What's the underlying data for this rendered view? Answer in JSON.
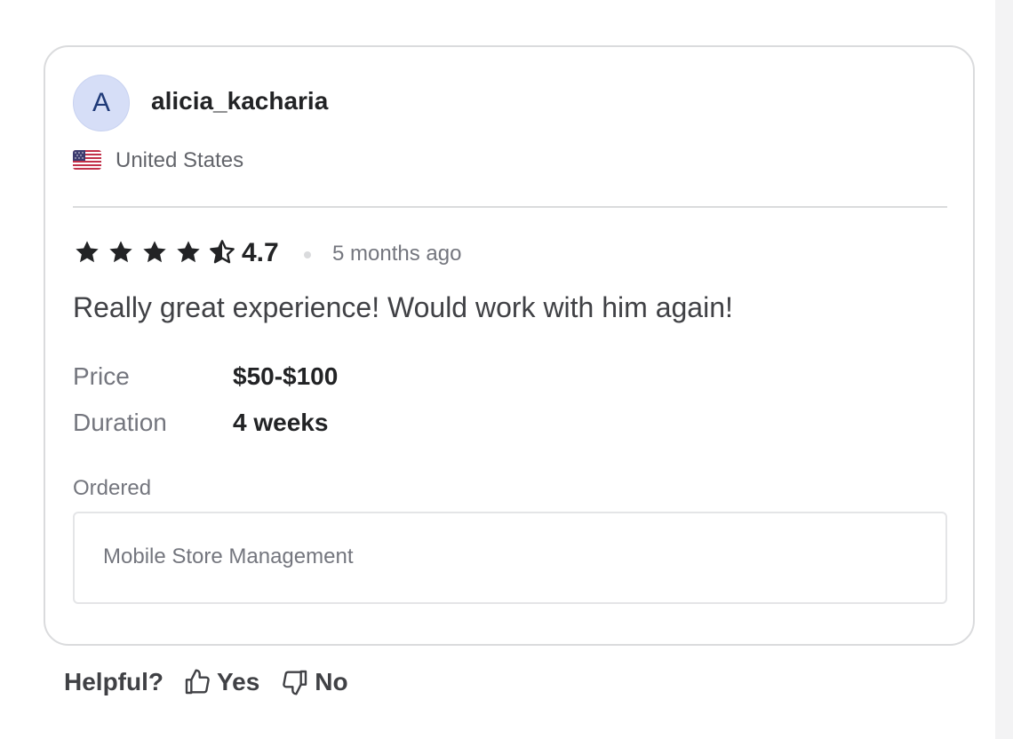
{
  "review": {
    "avatar_initial": "A",
    "username": "alicia_kacharia",
    "country": "United States",
    "flag_icon": "us-flag-icon",
    "rating": 4.7,
    "rating_text": "4.7",
    "stars": [
      "full",
      "full",
      "full",
      "full",
      "half"
    ],
    "time_ago": "5 months ago",
    "text": "Really great experience! Would work with him again!",
    "details": [
      {
        "label": "Price",
        "value": "$50-$100"
      },
      {
        "label": "Duration",
        "value": "4 weeks"
      }
    ],
    "ordered_label": "Ordered",
    "ordered_item": "Mobile Store Management"
  },
  "helpful": {
    "label": "Helpful?",
    "yes_label": "Yes",
    "no_label": "No",
    "yes_icon": "thumbs-up-icon",
    "no_icon": "thumbs-down-icon"
  },
  "colors": {
    "avatar_bg": "#d6def7",
    "avatar_text": "#1f3a78",
    "star": "#222325",
    "border": "#dadbdd"
  }
}
